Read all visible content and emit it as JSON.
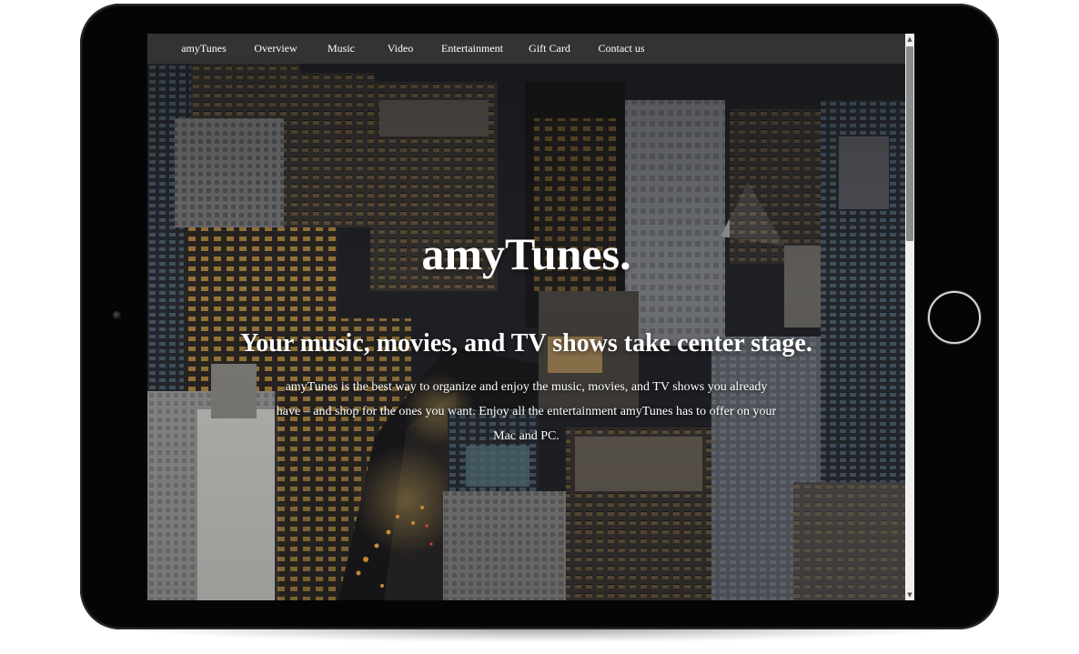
{
  "device": {
    "camera_icon": "front-camera-icon",
    "home_button_icon": "home-button-icon"
  },
  "nav": {
    "items": [
      {
        "label": "amyTunes"
      },
      {
        "label": "Overview"
      },
      {
        "label": "Music"
      },
      {
        "label": "Video"
      },
      {
        "label": "Entertainment"
      },
      {
        "label": "Gift Card"
      },
      {
        "label": "Contact us"
      }
    ]
  },
  "hero": {
    "title": "amyTunes.",
    "subtitle": "Your music, movies, and TV shows take center stage.",
    "description": "amyTunes is the best way to organize and enjoy the music, movies, and TV shows you already have – and shop for the ones you want. Enjoy all the entertainment amyTunes has to offer on your Mac and PC.",
    "background": "night city skyline aerial photo"
  },
  "scrollbar": {
    "up_icon": "scroll-up-arrow-icon",
    "down_icon": "scroll-down-arrow-icon"
  },
  "colors": {
    "navbar_bg": "#333333",
    "bezel": "#050505",
    "text": "#ffffff",
    "window_light": "#f2b84b"
  }
}
